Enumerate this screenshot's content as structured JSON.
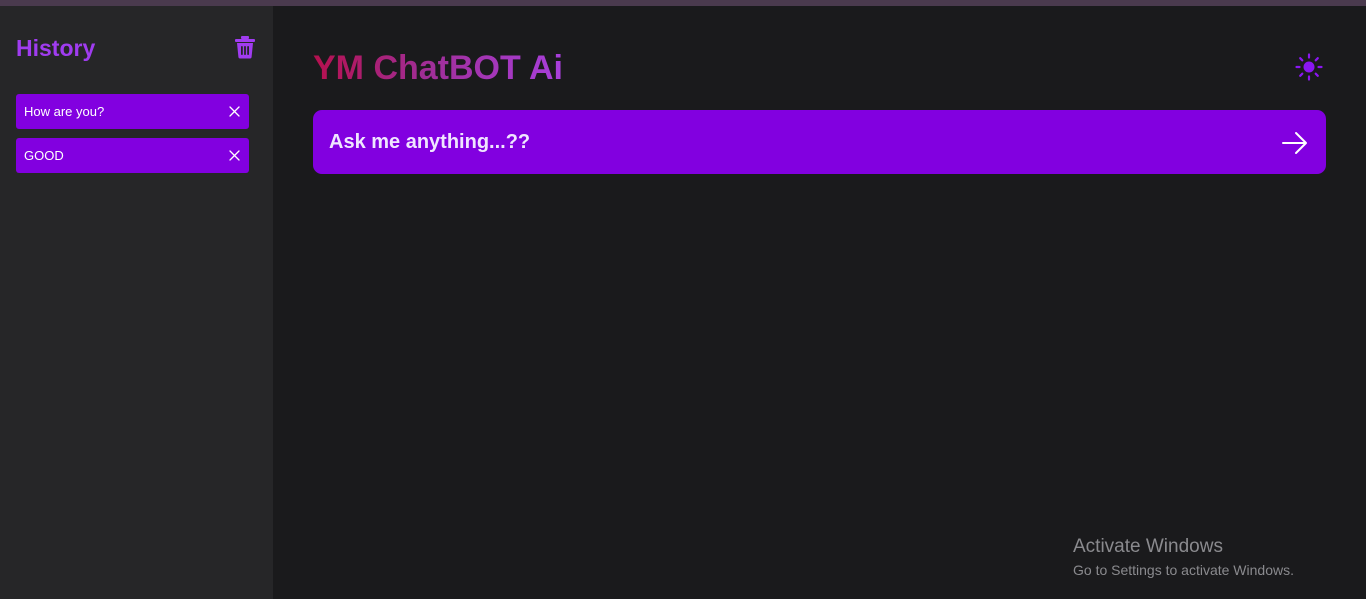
{
  "sidebar": {
    "title": "History",
    "clear_icon": "trash-icon",
    "items": [
      {
        "label": "How are you?",
        "close_icon": "close-icon"
      },
      {
        "label": "GOOD",
        "close_icon": "close-icon"
      }
    ]
  },
  "header": {
    "title": "YM ChatBOT Ai",
    "theme_icon": "sun-icon"
  },
  "prompt": {
    "placeholder": "Ask me anything...??",
    "value": "",
    "send_icon": "arrow-right-icon"
  },
  "watermark": {
    "title": "Activate Windows",
    "subtitle": "Go to Settings to activate Windows."
  },
  "colors": {
    "accent": "#8200e0",
    "sidebar_title": "#a03cf0",
    "sidebar_bg": "#262628",
    "main_bg": "#1a1a1c",
    "title_gradient_start": "#b5104e",
    "title_gradient_end": "#a83fdc"
  }
}
